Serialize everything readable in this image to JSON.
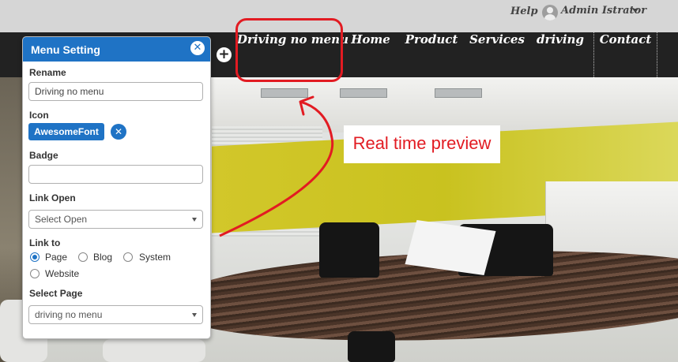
{
  "topbar": {
    "help": "Help",
    "user": "Admin Istrator",
    "avatar_icon": "user-avatar-icon",
    "caret_icon": "caret-down-icon"
  },
  "nav": {
    "add_icon": "plus-icon",
    "items": [
      {
        "label": "Driving no menu"
      },
      {
        "label": "Home"
      },
      {
        "label": "Product"
      },
      {
        "label": "Services"
      },
      {
        "label": "driving"
      },
      {
        "label": "Contact"
      }
    ]
  },
  "annotation": {
    "preview_text": "Real time preview",
    "color": "#e21b22"
  },
  "panel": {
    "title": "Menu Setting",
    "close_icon": "close-icon",
    "rename_label": "Rename",
    "rename_value": "Driving no menu",
    "icon_label": "Icon",
    "icon_value": "AwesomeFont",
    "icon_remove": "remove-icon",
    "badge_label": "Badge",
    "badge_value": "",
    "link_open_label": "Link Open",
    "link_open_value": "Select Open",
    "link_to_label": "Link to",
    "link_to_options": [
      {
        "label": "Page",
        "checked": true
      },
      {
        "label": "Blog",
        "checked": false
      },
      {
        "label": "System",
        "checked": false
      },
      {
        "label": "Website",
        "checked": false
      }
    ],
    "select_page_label": "Select Page",
    "select_page_value": "driving no menu",
    "accent_color": "#1f73c5"
  }
}
